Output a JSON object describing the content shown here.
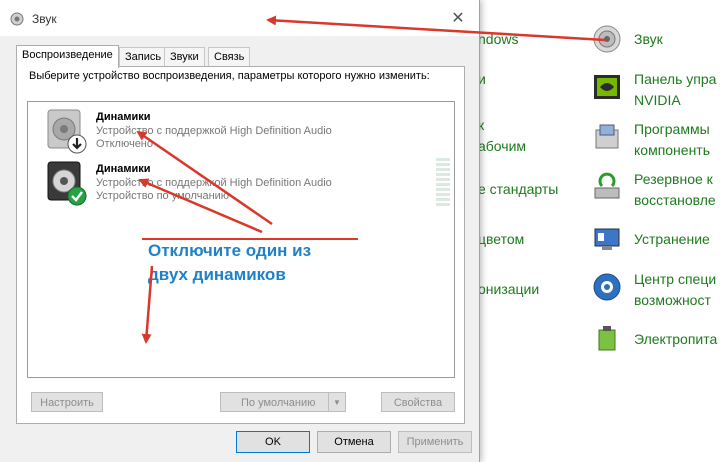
{
  "dialog": {
    "title": "Звук",
    "close_glyph": "✕",
    "tabs": [
      "Воспроизведение",
      "Запись",
      "Звуки",
      "Связь"
    ],
    "instruction": "Выберите устройство воспроизведения, параметры которого нужно изменить:",
    "devices": [
      {
        "name": "Динамики",
        "description": "Устройство с поддержкой High Definition Audio",
        "status": "Отключено",
        "badge_icon": "down-arrow-icon"
      },
      {
        "name": "Динамики",
        "description": "Устройство с поддержкой High Definition Audio",
        "status": "Устройство по умолчанию",
        "badge_icon": "check-icon"
      }
    ],
    "buttons": {
      "configure": "Настроить",
      "set_default": "По умолчанию",
      "properties": "Свойства",
      "ok": "OK",
      "cancel": "Отмена",
      "apply": "Применить"
    }
  },
  "annotation": {
    "line1": "Отключите один из",
    "line2": "двух динамиков"
  },
  "background_fragments": [
    "ndows",
    "и",
    "к",
    "абочим",
    "е стандарты",
    "цветом",
    "онизации"
  ],
  "control_panel": [
    {
      "icon": "speaker-icon",
      "label": "Звук"
    },
    {
      "icon": "nvidia-icon",
      "label": "Панель упра",
      "label2": "NVIDIA"
    },
    {
      "icon": "programs-icon",
      "label": "Программы",
      "label2": "компоненть"
    },
    {
      "icon": "backup-icon",
      "label": "Резервное к",
      "label2": "восстановле"
    },
    {
      "icon": "troubleshoot-icon",
      "label": "Устранение"
    },
    {
      "icon": "ease-of-access-icon",
      "label": "Центр специ",
      "label2": "возможност"
    },
    {
      "icon": "power-icon",
      "label": "Электропита"
    }
  ],
  "colors": {
    "link_green": "#1e7a1e",
    "annotation_blue": "#1f82c8",
    "arrow_red": "#d9392a"
  }
}
